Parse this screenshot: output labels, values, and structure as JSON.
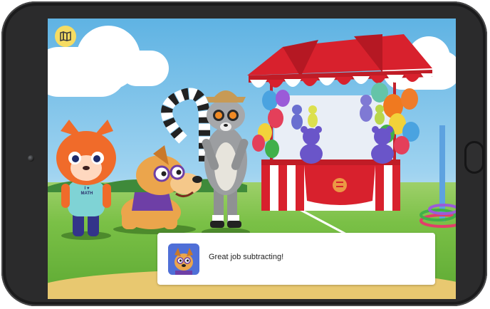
{
  "device": {
    "type": "tablet",
    "bezel_color": "#2b2b2c"
  },
  "toolbar": {
    "map_button_icon": "map-icon",
    "map_button_color": "#f5dc63"
  },
  "scene": {
    "fox_shirt": {
      "line1": "I",
      "heart": "♥",
      "line2": "MATH"
    },
    "booth_colors": {
      "red": "#d8212d",
      "white": "#ffffff"
    }
  },
  "dialog": {
    "avatar_icon": "dog-avatar-icon",
    "message": "Great job subtracting!"
  }
}
